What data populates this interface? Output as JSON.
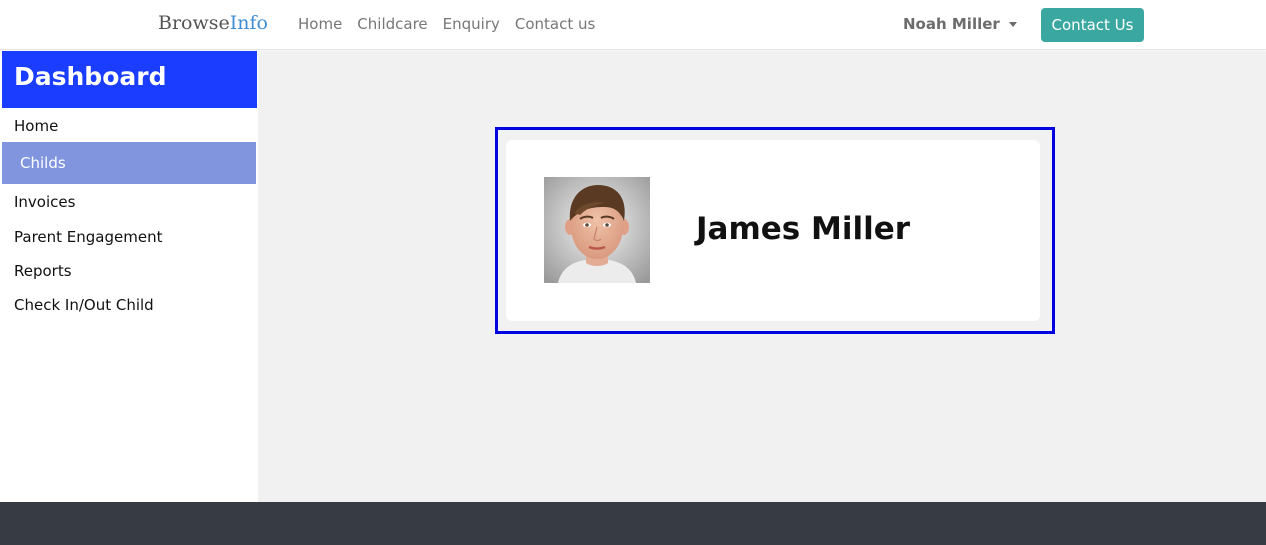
{
  "navbar": {
    "brand_part1": "Browse",
    "brand_part2": "Info",
    "links": [
      "Home",
      "Childcare",
      "Enquiry",
      "Contact us"
    ],
    "user_name": "Noah Miller",
    "contact_button": "Contact Us"
  },
  "sidebar": {
    "title": "Dashboard",
    "items": [
      {
        "label": "Home"
      },
      {
        "label": "Childs",
        "active": true
      },
      {
        "label": "Invoices"
      },
      {
        "label": "Parent Engagement"
      },
      {
        "label": "Reports"
      },
      {
        "label": "Check In/Out Child"
      }
    ]
  },
  "main": {
    "child_card": {
      "name": "James Miller"
    }
  },
  "colors": {
    "brand_accent": "#3d8fd1",
    "sidebar_header": "#1a3dff",
    "sidebar_active": "#8195de",
    "contact_button": "#3aa8a0",
    "card_outline": "#0000e0",
    "footer": "#363b44"
  }
}
